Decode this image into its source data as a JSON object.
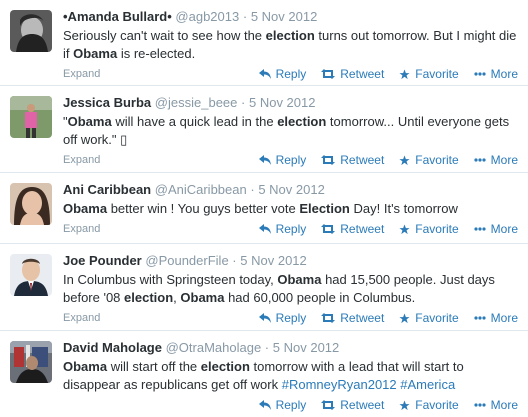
{
  "action_labels": {
    "expand": "Expand",
    "reply": "Reply",
    "retweet": "Retweet",
    "favorite": "Favorite",
    "more": "More"
  },
  "tweets": [
    {
      "name": "•Amanda Bullard•",
      "handle": "@agb2013",
      "time": "5 Nov 2012",
      "segments": [
        {
          "t": "Seriously can't wait to see how the "
        },
        {
          "t": "election",
          "b": true
        },
        {
          "t": " turns out tomorrow. But I might die if "
        },
        {
          "t": "Obama",
          "b": true
        },
        {
          "t": " is re-elected."
        }
      ]
    },
    {
      "name": "Jessica Burba",
      "handle": "@jessie_beee",
      "time": "5 Nov 2012",
      "segments": [
        {
          "t": "\""
        },
        {
          "t": "Obama",
          "b": true
        },
        {
          "t": " will have a quick lead in the "
        },
        {
          "t": "election",
          "b": true
        },
        {
          "t": " tomorrow... Until everyone gets off work.\" ▯"
        }
      ]
    },
    {
      "name": "Ani Caribbean",
      "handle": "@AniCaribbean",
      "time": "5 Nov 2012",
      "segments": [
        {
          "t": "Obama",
          "b": true
        },
        {
          "t": " better win ! You guys better vote "
        },
        {
          "t": "Election",
          "b": true
        },
        {
          "t": " Day! It's tomorrow"
        }
      ]
    },
    {
      "name": "Joe Pounder",
      "handle": "@PounderFile",
      "time": "5 Nov 2012",
      "segments": [
        {
          "t": "In Columbus with Springsteen today, "
        },
        {
          "t": "Obama",
          "b": true
        },
        {
          "t": " had 15,500 people. Just days before '08 "
        },
        {
          "t": "election",
          "b": true
        },
        {
          "t": ", "
        },
        {
          "t": "Obama",
          "b": true
        },
        {
          "t": " had 60,000 people in Columbus."
        }
      ]
    },
    {
      "name": "David Maholage",
      "handle": "@OtraMaholage",
      "time": "5 Nov 2012",
      "segments": [
        {
          "t": "Obama",
          "b": true
        },
        {
          "t": " will start off the "
        },
        {
          "t": "election",
          "b": true
        },
        {
          "t": " tomorrow with a lead that will start to disappear as republicans get off work "
        },
        {
          "t": "#RomneyRyan2012",
          "h": true
        },
        {
          "t": " "
        },
        {
          "t": "#America",
          "h": true
        }
      ]
    }
  ]
}
